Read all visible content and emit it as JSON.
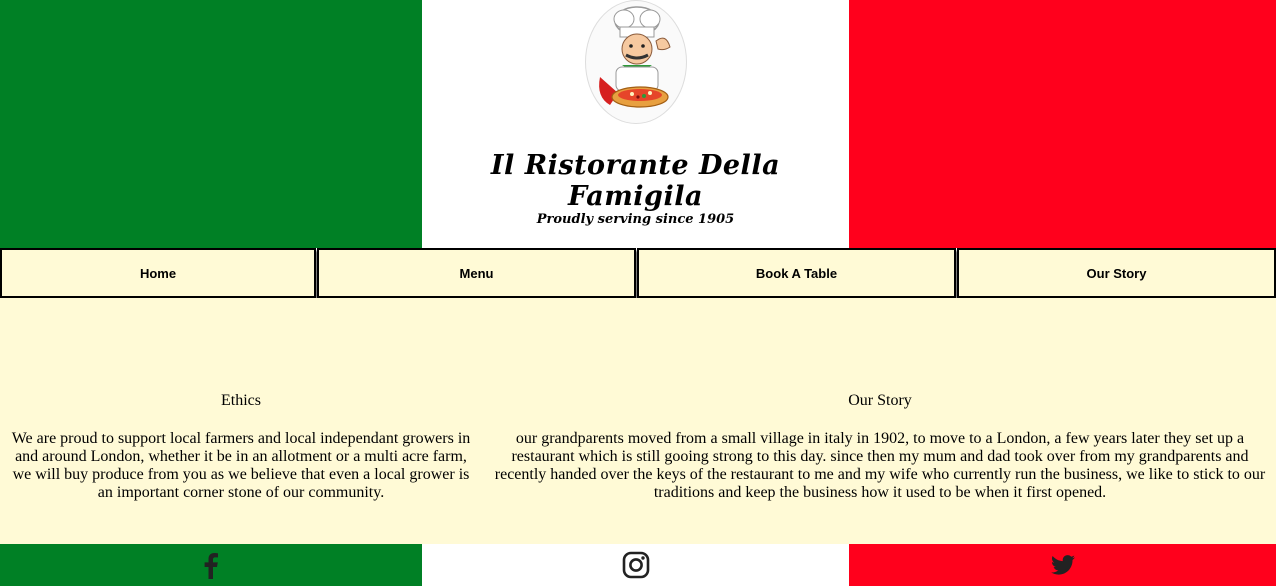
{
  "colors": {
    "green": "#008025",
    "red": "#ff001c",
    "cream": "#fffad6",
    "icon": "#222222"
  },
  "header": {
    "logo_icon": "chef-with-pizza-icon",
    "title": "Il Ristorante Della Famigila",
    "subtitle": "Proudly serving since 1905"
  },
  "nav": {
    "items": [
      {
        "label": "Home"
      },
      {
        "label": "Menu"
      },
      {
        "label": "Book A Table"
      },
      {
        "label": "Our Story"
      }
    ]
  },
  "main": {
    "ethics": {
      "heading": "Ethics",
      "body": "We are proud to support local farmers and local independant growers in and around London, whether it be in an allotment or a multi acre farm, we will buy produce from you as we believe that even a local grower is an important corner stone of our community."
    },
    "story": {
      "heading": "Our Story",
      "body": "our grandparents moved from a small village in italy in 1902, to move to a London, a few years later they set up a restaurant which is still gooing strong to this day. since then my mum and dad took over from my grandparents and recently handed over the keys of the restaurant to me and my wife who currently run the business, we like to stick to our traditions and keep the business how it used to be when it first opened."
    }
  },
  "footer": {
    "icons": [
      "facebook-icon",
      "instagram-icon",
      "twitter-icon"
    ]
  }
}
